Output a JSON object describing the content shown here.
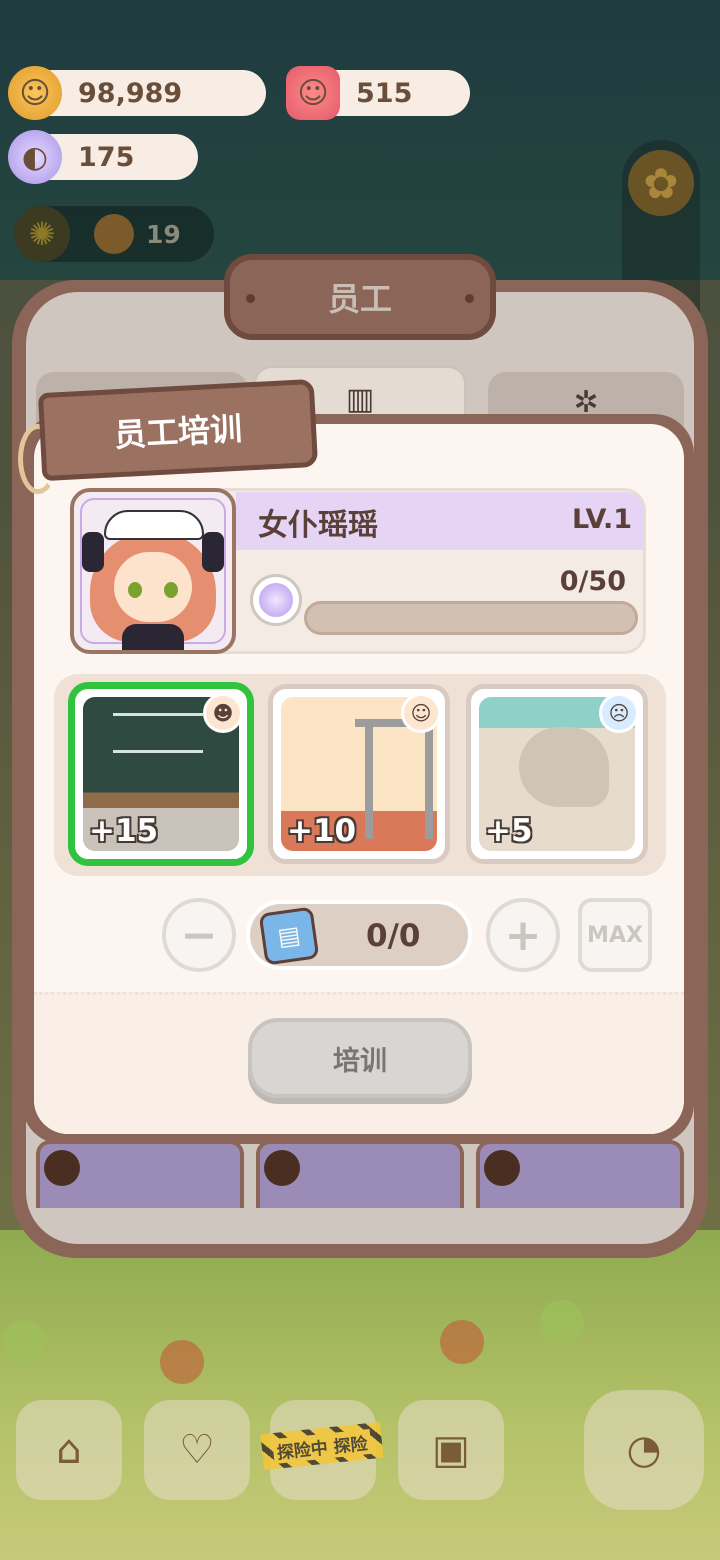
{
  "currencies": {
    "cookies": "98,989",
    "gems": "515",
    "candy": "175"
  },
  "mini_counter": {
    "value": "19"
  },
  "dialog": {
    "title": "员工",
    "tabs": [
      {
        "icon": "location-icon",
        "active": false
      },
      {
        "icon": "book-icon",
        "active": true
      },
      {
        "icon": "gear-group-icon",
        "active": false
      }
    ]
  },
  "training": {
    "ribbon_title": "员工培训",
    "employee": {
      "name": "女仆瑶瑶",
      "level": "LV.1",
      "exp": "0/50",
      "exp_fraction": 0
    },
    "options": [
      {
        "bonus": "+15",
        "scene": "classroom",
        "mood": "laughing",
        "selected": true
      },
      {
        "bonus": "+10",
        "scene": "gym",
        "mood": "smile",
        "selected": false
      },
      {
        "bonus": "+5",
        "scene": "rock-garden",
        "mood": "tired",
        "selected": false
      }
    ],
    "quantity": "0/0",
    "max_label": "MAX",
    "train_button": "培训"
  },
  "bottom_bar": {
    "explore_label": "探险中 探险"
  },
  "colors": {
    "selected_border": "#2fc33e",
    "exp_fill": "#b98df0",
    "panel_brown": "#8b6658"
  }
}
